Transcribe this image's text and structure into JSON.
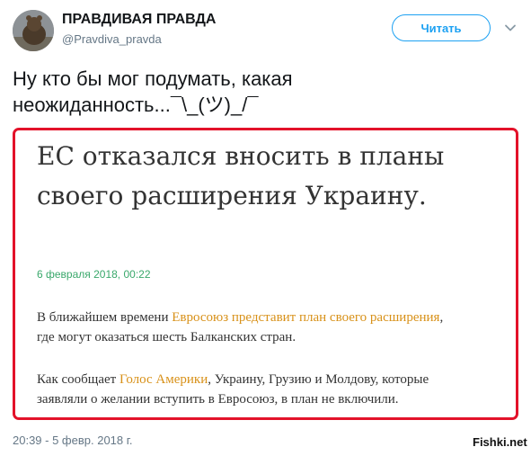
{
  "tweet": {
    "author_name": "ПРАВДИВАЯ ПРАВДА",
    "author_handle": "@Pravdiva_pravda",
    "follow_label": "Читать",
    "text_lines": [
      "Ну кто бы мог подумать, какая",
      "неожиданность...¯\\_(ツ)_/¯"
    ],
    "timestamp": "20:39 - 5 февр. 2018 г."
  },
  "article": {
    "headline_lines": [
      "ЕС отказался вносить в планы",
      "своего расширения Украину."
    ],
    "date": "6 февраля 2018, 00:22",
    "para1": {
      "line1_before": "В ближайшем времени ",
      "line1_link": "Евросоюз представит план своего расширения",
      "line1_after": ",",
      "line2": "где могут оказаться шесть Балканских стран."
    },
    "para2": {
      "line1_before": "Как сообщает ",
      "line1_link": "Голос Америки",
      "line1_after": ", Украину, Грузию и Молдову, которые",
      "line2": "заявляли о желании вступить в Евросоюз, в план не включили."
    },
    "highlight_border_color": "#e3122a",
    "link_color": "#d89119",
    "date_color": "#3aa86b"
  },
  "watermark": {
    "text": "Fishki.net"
  },
  "colors": {
    "accent": "#1da1f2",
    "secondary_text": "#657786"
  }
}
